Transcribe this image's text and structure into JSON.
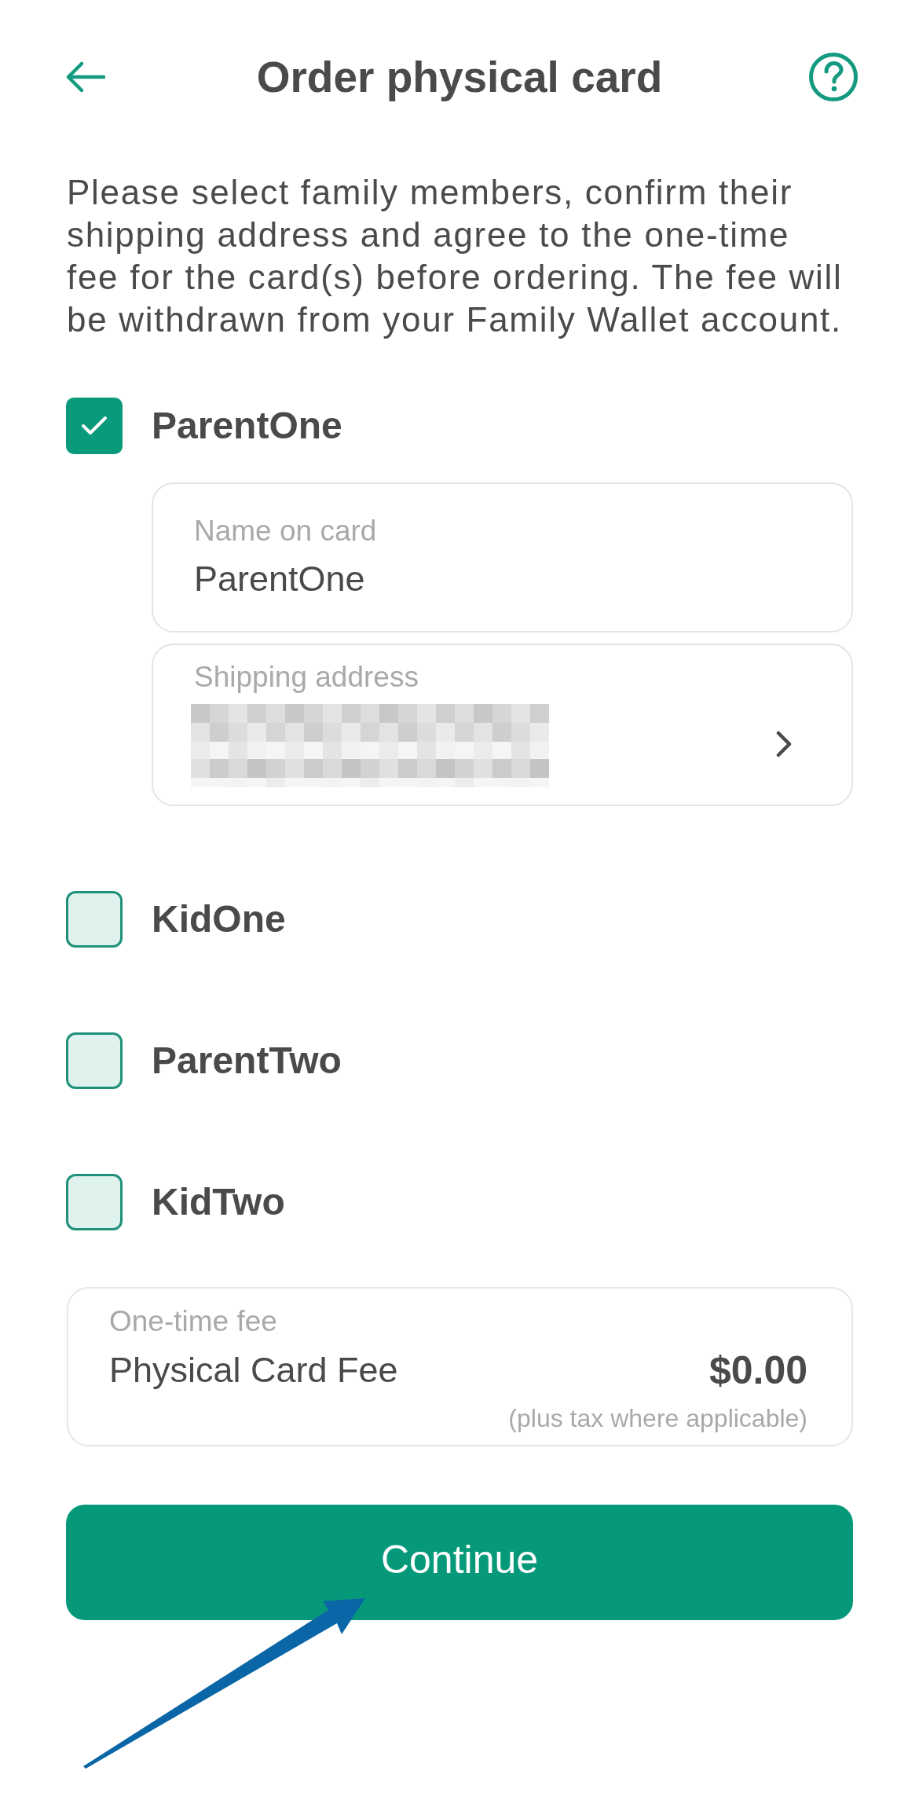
{
  "header": {
    "title": "Order physical card"
  },
  "instructions": "Please select family members, confirm their shipping address and agree to the one-time fee for the card(s) before ordering. The fee will be withdrawn from your Family Wallet account.",
  "members": [
    {
      "name": "ParentOne",
      "checked": true,
      "name_on_card": {
        "label": "Name on card",
        "value": "ParentOne"
      },
      "shipping_address": {
        "label": "Shipping address"
      }
    },
    {
      "name": "KidOne",
      "checked": false
    },
    {
      "name": "ParentTwo",
      "checked": false
    },
    {
      "name": "KidTwo",
      "checked": false
    }
  ],
  "fee": {
    "label": "One-time fee",
    "item": "Physical Card Fee",
    "amount": "$0.00",
    "note": "(plus tax where applicable)"
  },
  "continue_button": {
    "label": "Continue"
  }
}
